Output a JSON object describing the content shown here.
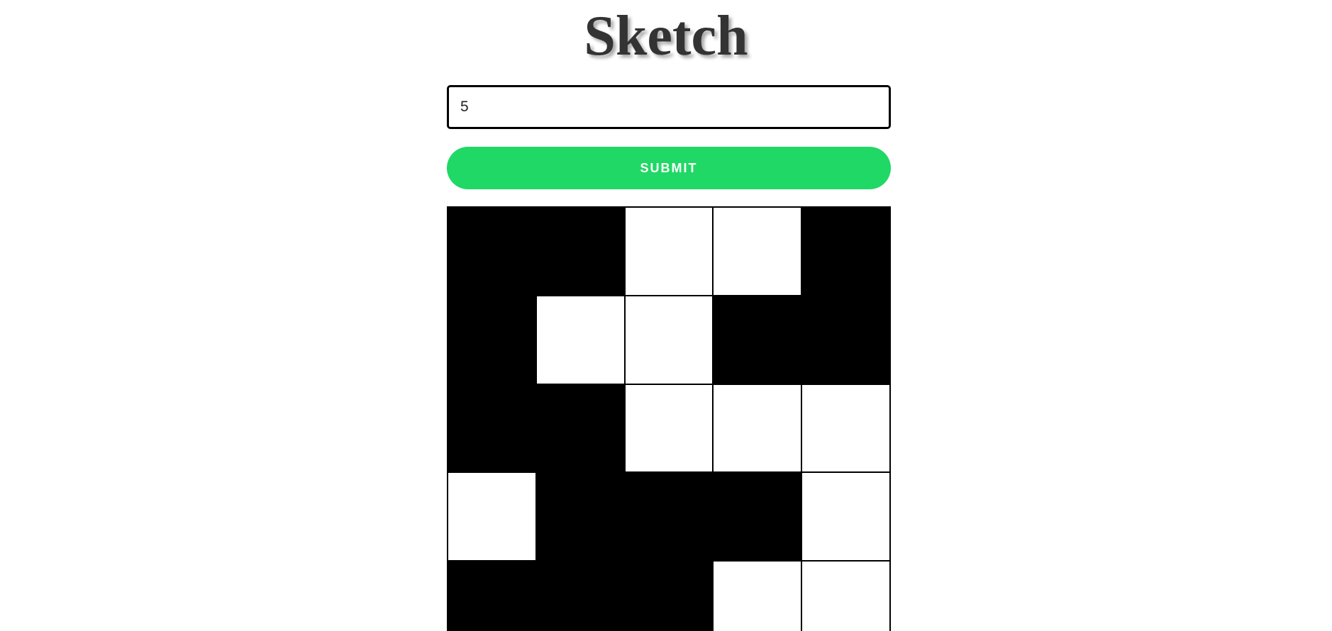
{
  "header": {
    "title": "Sketch"
  },
  "controls": {
    "size_value": "5",
    "submit_label": "SUBMIT"
  },
  "colors": {
    "accent": "#20d865",
    "filled": "#000000",
    "empty": "#ffffff"
  },
  "grid": {
    "size": 5,
    "cells": [
      [
        1,
        1,
        0,
        0,
        1
      ],
      [
        1,
        0,
        0,
        1,
        1
      ],
      [
        1,
        1,
        0,
        0,
        0
      ],
      [
        0,
        1,
        1,
        1,
        0
      ],
      [
        1,
        1,
        1,
        0,
        0
      ]
    ]
  }
}
